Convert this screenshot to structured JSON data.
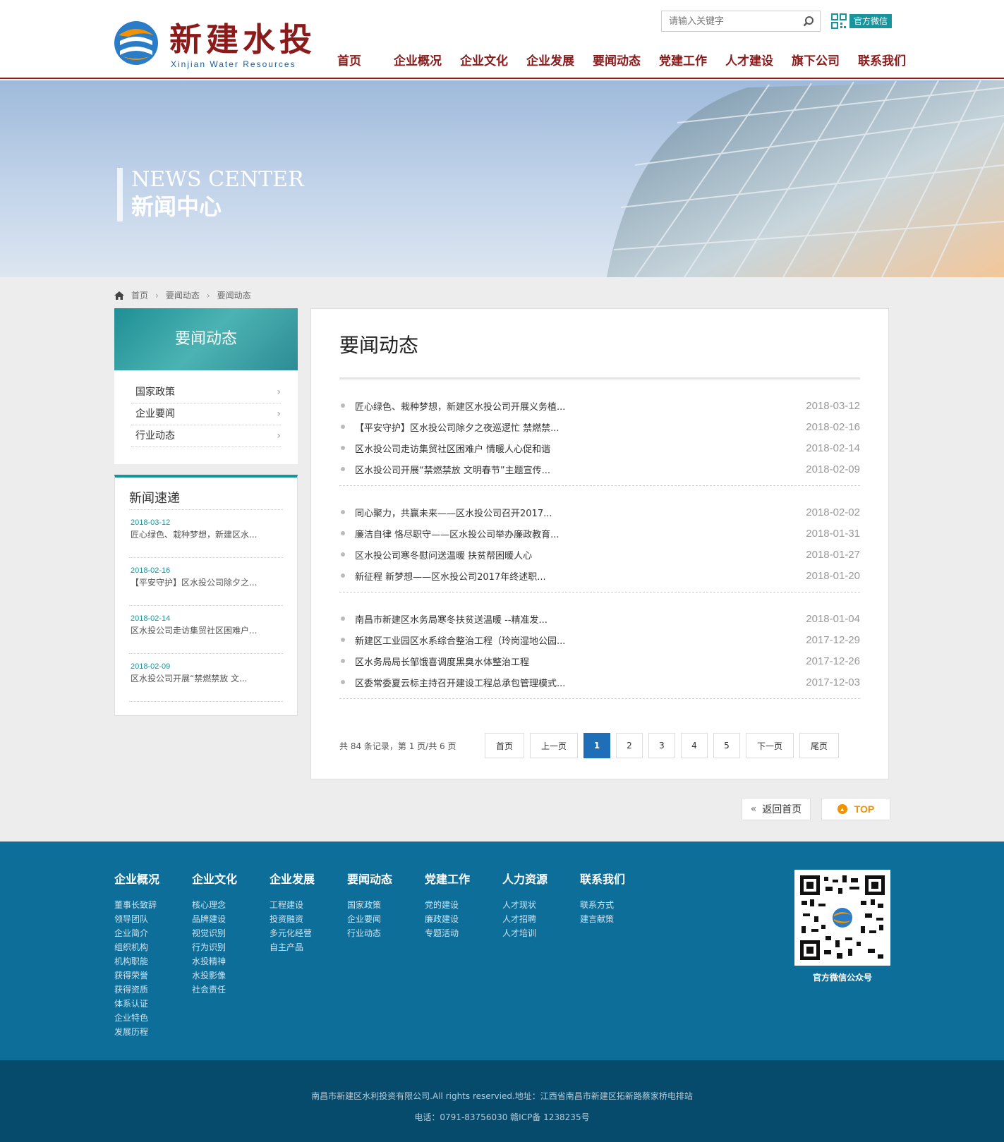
{
  "header": {
    "logo_cn": "新建水投",
    "logo_en": "Xinjian Water Resources",
    "search_placeholder": "请输入关键字",
    "wechat_label": "官方微信",
    "nav": [
      "首页",
      "企业概况",
      "企业文化",
      "企业发展",
      "要闻动态",
      "党建工作",
      "人才建设",
      "旗下公司",
      "联系我们"
    ]
  },
  "banner": {
    "en": "NEWS CENTER",
    "cn": "新闻中心"
  },
  "breadcrumb": [
    "首页",
    "要闻动态",
    "要闻动态"
  ],
  "sidebar": {
    "title": "要闻动态",
    "items": [
      "国家政策",
      "企业要闻",
      "行业动态"
    ],
    "quick_title": "新闻速递",
    "quick": [
      {
        "date": "2018-03-12",
        "text": "匠心绿色、栽种梦想，新建区水..."
      },
      {
        "date": "2018-02-16",
        "text": "【平安守护】区水投公司除夕之..."
      },
      {
        "date": "2018-02-14",
        "text": "区水投公司走访集贸社区困难户..."
      },
      {
        "date": "2018-02-09",
        "text": "区水投公司开展“禁燃禁放 文..."
      }
    ]
  },
  "main": {
    "title": "要闻动态",
    "groups": [
      [
        {
          "title": "匠心绿色、栽种梦想，新建区水投公司开展义务植...",
          "date": "2018-03-12"
        },
        {
          "title": "【平安守护】区水投公司除夕之夜巡逻忙 禁燃禁...",
          "date": "2018-02-16"
        },
        {
          "title": "区水投公司走访集贸社区困难户 情暖人心促和谐",
          "date": "2018-02-14"
        },
        {
          "title": "区水投公司开展“禁燃禁放 文明春节”主题宣传...",
          "date": "2018-02-09"
        }
      ],
      [
        {
          "title": "同心聚力，共赢未来——区水投公司召开2017...",
          "date": "2018-02-02"
        },
        {
          "title": "廉洁自律 恪尽职守——区水投公司举办廉政教育...",
          "date": "2018-01-31"
        },
        {
          "title": "区水投公司寒冬慰问送温暖 扶贫帮困暖人心",
          "date": "2018-01-27"
        },
        {
          "title": "新征程 新梦想——区水投公司2017年终述职...",
          "date": "2018-01-20"
        }
      ],
      [
        {
          "title": "南昌市新建区水务局寒冬扶贫送温暖 --精准发...",
          "date": "2018-01-04"
        },
        {
          "title": "新建区工业园区水系综合整治工程（玲岗湿地公园...",
          "date": "2017-12-29"
        },
        {
          "title": "区水务局局长邹饿喜调度黑臭水体整治工程",
          "date": "2017-12-26"
        },
        {
          "title": "区委常委夏云标主持召开建设工程总承包管理模式...",
          "date": "2017-12-03"
        }
      ]
    ],
    "pager": {
      "info": "共 84 条记录，第 1 页/共 6 页",
      "first": "首页",
      "prev": "上一页",
      "pages": [
        "1",
        "2",
        "3",
        "4",
        "5"
      ],
      "next": "下一页",
      "last": "尾页"
    }
  },
  "float": {
    "back_home": "返回首页",
    "top": "TOP"
  },
  "footer": {
    "columns": [
      {
        "title": "企业概况",
        "links": [
          "董事长致辞",
          "领导团队",
          "企业简介",
          "组织机构",
          "机构职能",
          "获得荣誉",
          "获得资质",
          "体系认证",
          "企业特色",
          "发展历程"
        ]
      },
      {
        "title": "企业文化",
        "links": [
          "核心理念",
          "品牌建设",
          "视觉识别",
          "行为识别",
          "水投精神",
          "水投影像",
          "社会责任"
        ]
      },
      {
        "title": "企业发展",
        "links": [
          "工程建设",
          "投资融资",
          "多元化经营",
          "自主产品"
        ]
      },
      {
        "title": "要闻动态",
        "links": [
          "国家政策",
          "企业要闻",
          "行业动态"
        ]
      },
      {
        "title": "党建工作",
        "links": [
          "党的建设",
          "廉政建设",
          "专题活动"
        ]
      },
      {
        "title": "人力资源",
        "links": [
          "人才现状",
          "人才招聘",
          "人才培训"
        ]
      },
      {
        "title": "联系我们",
        "links": [
          "联系方式",
          "建言献策"
        ]
      }
    ],
    "qr_label": "官方微信公众号",
    "copyright": "南昌市新建区水利投资有限公司.All rights reservied.地址：江西省南昌市新建区拓新路蔡家桥电排站",
    "contact": "电话：0791-83756030 赣ICP备 1238235号"
  },
  "colors": {
    "brand": "#8b1a1a",
    "accent": "#17959c",
    "footer": "#0e6e9a",
    "active_page": "#1f6eb8"
  }
}
